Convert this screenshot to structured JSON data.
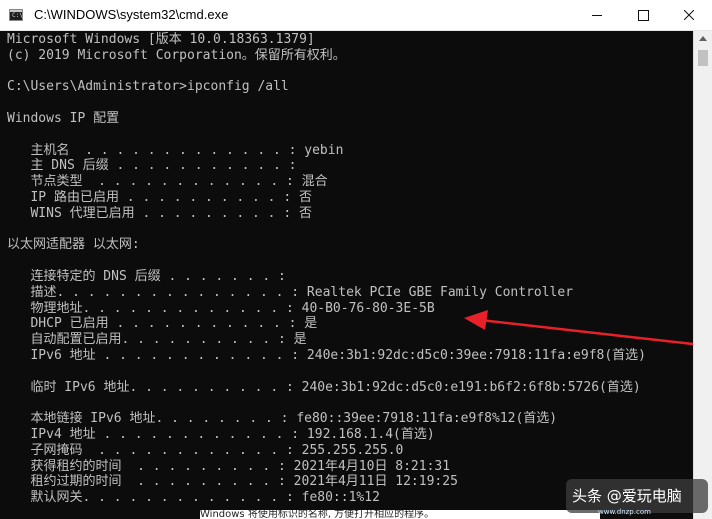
{
  "window": {
    "title": "C:\\WINDOWS\\system32\\cmd.exe",
    "icon_text": "C:\\",
    "buttons": [
      "minimize-icon",
      "maximize-icon",
      "close-icon"
    ]
  },
  "console": {
    "lines": [
      "Microsoft Windows [版本 10.0.18363.1379]",
      "(c) 2019 Microsoft Corporation。保留所有权利。",
      "",
      "C:\\Users\\Administrator>ipconfig /all",
      "",
      "Windows IP 配置",
      "",
      "   主机名  . . . . . . . . . . . . . : yebin",
      "   主 DNS 后缀 . . . . . . . . . . . :",
      "   节点类型  . . . . . . . . . . . . : 混合",
      "   IP 路由已启用 . . . . . . . . . . : 否",
      "   WINS 代理已启用 . . . . . . . . . : 否",
      "",
      "以太网适配器 以太网:",
      "",
      "   连接特定的 DNS 后缀 . . . . . . . :",
      "   描述. . . . . . . . . . . . . . . : Realtek PCIe GBE Family Controller",
      "   物理地址. . . . . . . . . . . . . : 40-B0-76-80-3E-5B",
      "   DHCP 已启用 . . . . . . . . . . . : 是",
      "   自动配置已启用. . . . . . . . . . : 是",
      "   IPv6 地址 . . . . . . . . . . . . : 240e:3b1:92dc:d5c0:39ee:7918:11fa:e9f8(首选)",
      "",
      "   临时 IPv6 地址. . . . . . . . . . : 240e:3b1:92dc:d5c0:e191:b6f2:6f8b:5726(首选)",
      "",
      "   本地链接 IPv6 地址. . . . . . . . : fe80::39ee:7918:11fa:e9f8%12(首选)",
      "   IPv4 地址 . . . . . . . . . . . . : 192.168.1.4(首选)",
      "   子网掩码  . . . . . . . . . . . . : 255.255.255.0",
      "   获得租约的时间  . . . . . . . . . : 2021年4月10日 8:21:31",
      "   租约过期的时间  . . . . . . . . . : 2021年4月11日 12:19:25",
      "   默认网关. . . . . . . . . . . . . : fe80::1%12"
    ]
  },
  "watermark": {
    "text": "头条 @爱玩电脑",
    "domain": "www.dnzp.com"
  },
  "background_snippet": "Windows 将使用标识的名称, 方便打开相应的程序。",
  "colors": {
    "console_bg": "#0c0c0c",
    "console_fg": "#c0c0c0",
    "arrow": "#e8202a",
    "titlebar_bg": "#ffffff"
  }
}
